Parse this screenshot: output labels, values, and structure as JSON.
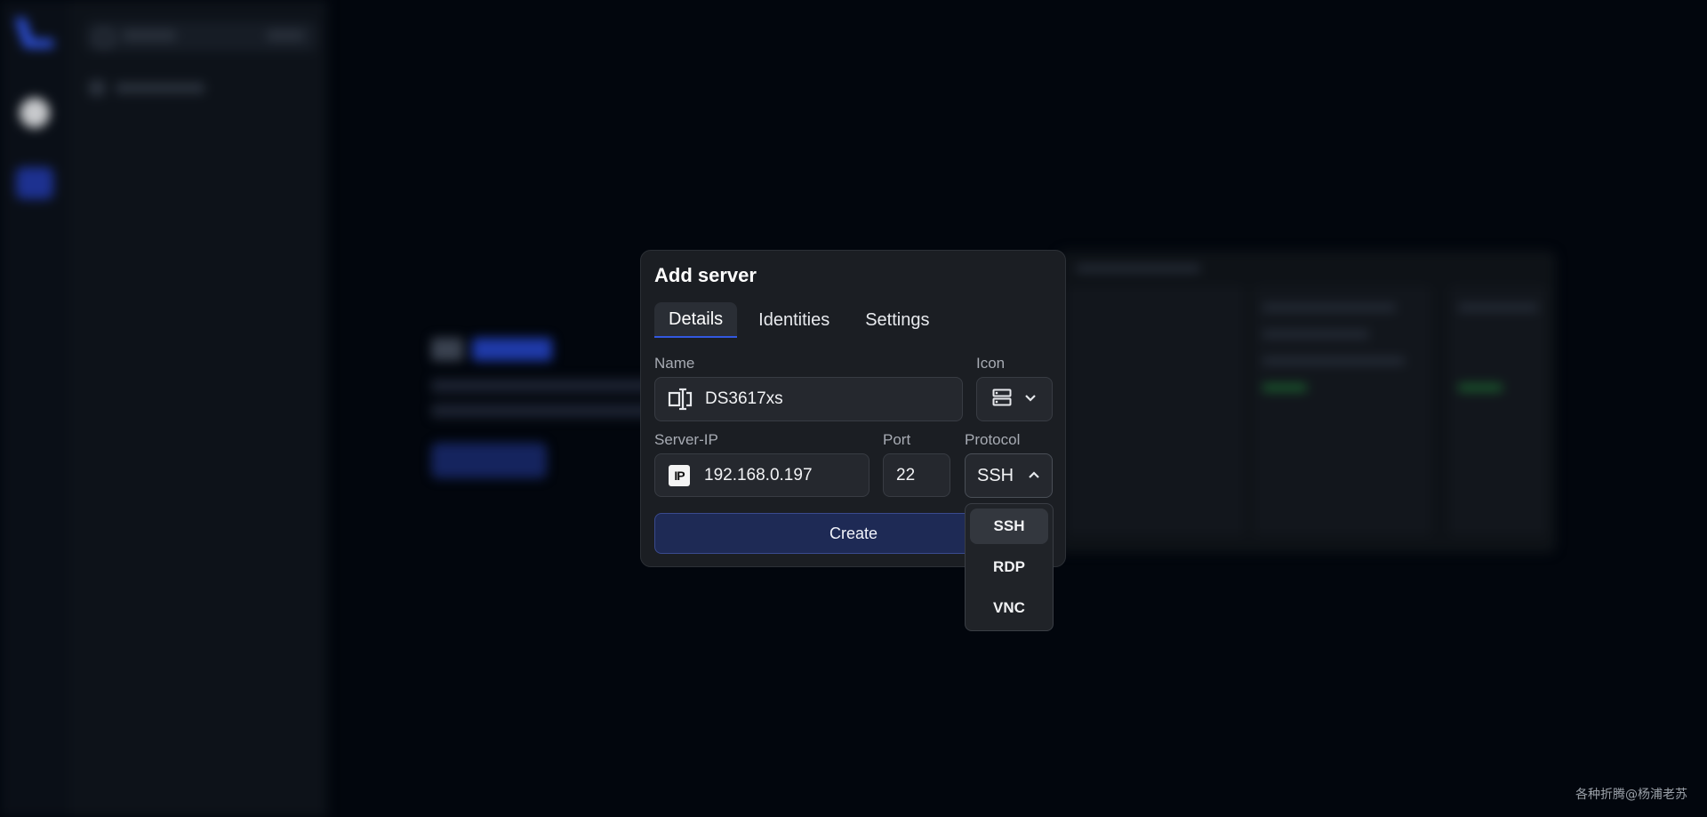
{
  "modal": {
    "title": "Add server",
    "tabs": [
      {
        "label": "Details",
        "active": true
      },
      {
        "label": "Identities",
        "active": false
      },
      {
        "label": "Settings",
        "active": false
      }
    ],
    "name_label": "Name",
    "name_value": "DS3617xs",
    "icon_label": "Icon",
    "icon_selected": "server-icon",
    "ip_label": "Server-IP",
    "ip_badge": "IP",
    "ip_value": "192.168.0.197",
    "port_label": "Port",
    "port_value": "22",
    "protocol_label": "Protocol",
    "protocol_value": "SSH",
    "create_label": "Create"
  },
  "protocol_dropdown": {
    "open": true,
    "options": [
      "SSH",
      "RDP",
      "VNC"
    ],
    "selected": "SSH"
  },
  "colors": {
    "accent": "#3258e0",
    "modal_bg": "#1b1e23",
    "page_bg": "#02060d",
    "create_button_bg": "#1e2a55"
  },
  "watermark": "各种折腾@杨浦老苏"
}
